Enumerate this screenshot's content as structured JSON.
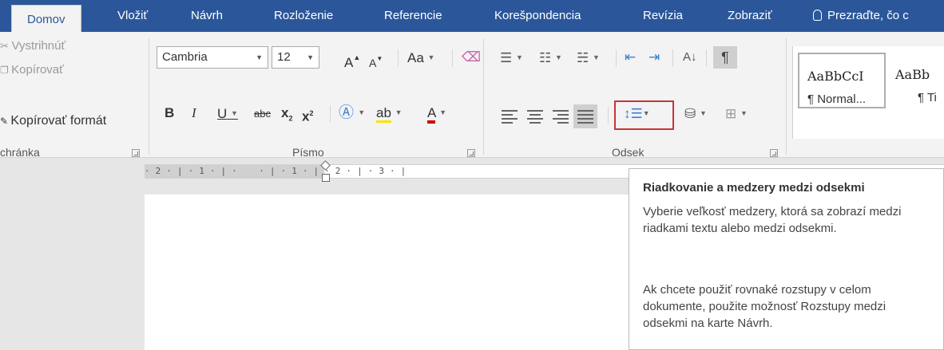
{
  "tabs": {
    "home": "Domov",
    "insert": "Vložiť",
    "design": "Návrh",
    "layout": "Rozloženie",
    "references": "Referencie",
    "mailings": "Korešpondencia",
    "review": "Revízia",
    "view": "Zobraziť",
    "tell_me": "Prezraďte, čo c"
  },
  "clipboard": {
    "cut": "Vystrihnúť",
    "copy": "Kopírovať",
    "format_painter": "Kopírovať formát",
    "group_label": "chránka"
  },
  "font": {
    "family": "Cambria",
    "size": "12",
    "change_case": "Aa",
    "bold": "B",
    "italic": "I",
    "underline": "U",
    "strikethrough": "abc",
    "subscript": "x",
    "superscript": "x",
    "group_label": "Písmo"
  },
  "paragraph": {
    "group_label": "Odsek",
    "show_marks": "¶"
  },
  "styles": {
    "normal_sample": "AaBbCcI",
    "normal_name": "¶ Normal...",
    "title_sample": "AaBb",
    "title_name": "¶ Ti"
  },
  "ruler": {
    "text": "· 2 · | · 1 · | ·    · | · 1 · | · 2 · | · 3 · |"
  },
  "tooltip": {
    "title": "Riadkovanie a medzery medzi odsekmi",
    "para1": "Vyberie veľkosť medzery, ktorá sa zobrazí medzi riadkami textu alebo medzi odsekmi.",
    "para2": "Ak chcete použiť rovnaké rozstupy v celom dokumente, použite možnosť Rozstupy medzi odsekmi na karte Návrh."
  },
  "colors": {
    "tab_bar": "#2b579a",
    "highlight_border": "#c8343b",
    "font_color_bar": "#d10000"
  }
}
